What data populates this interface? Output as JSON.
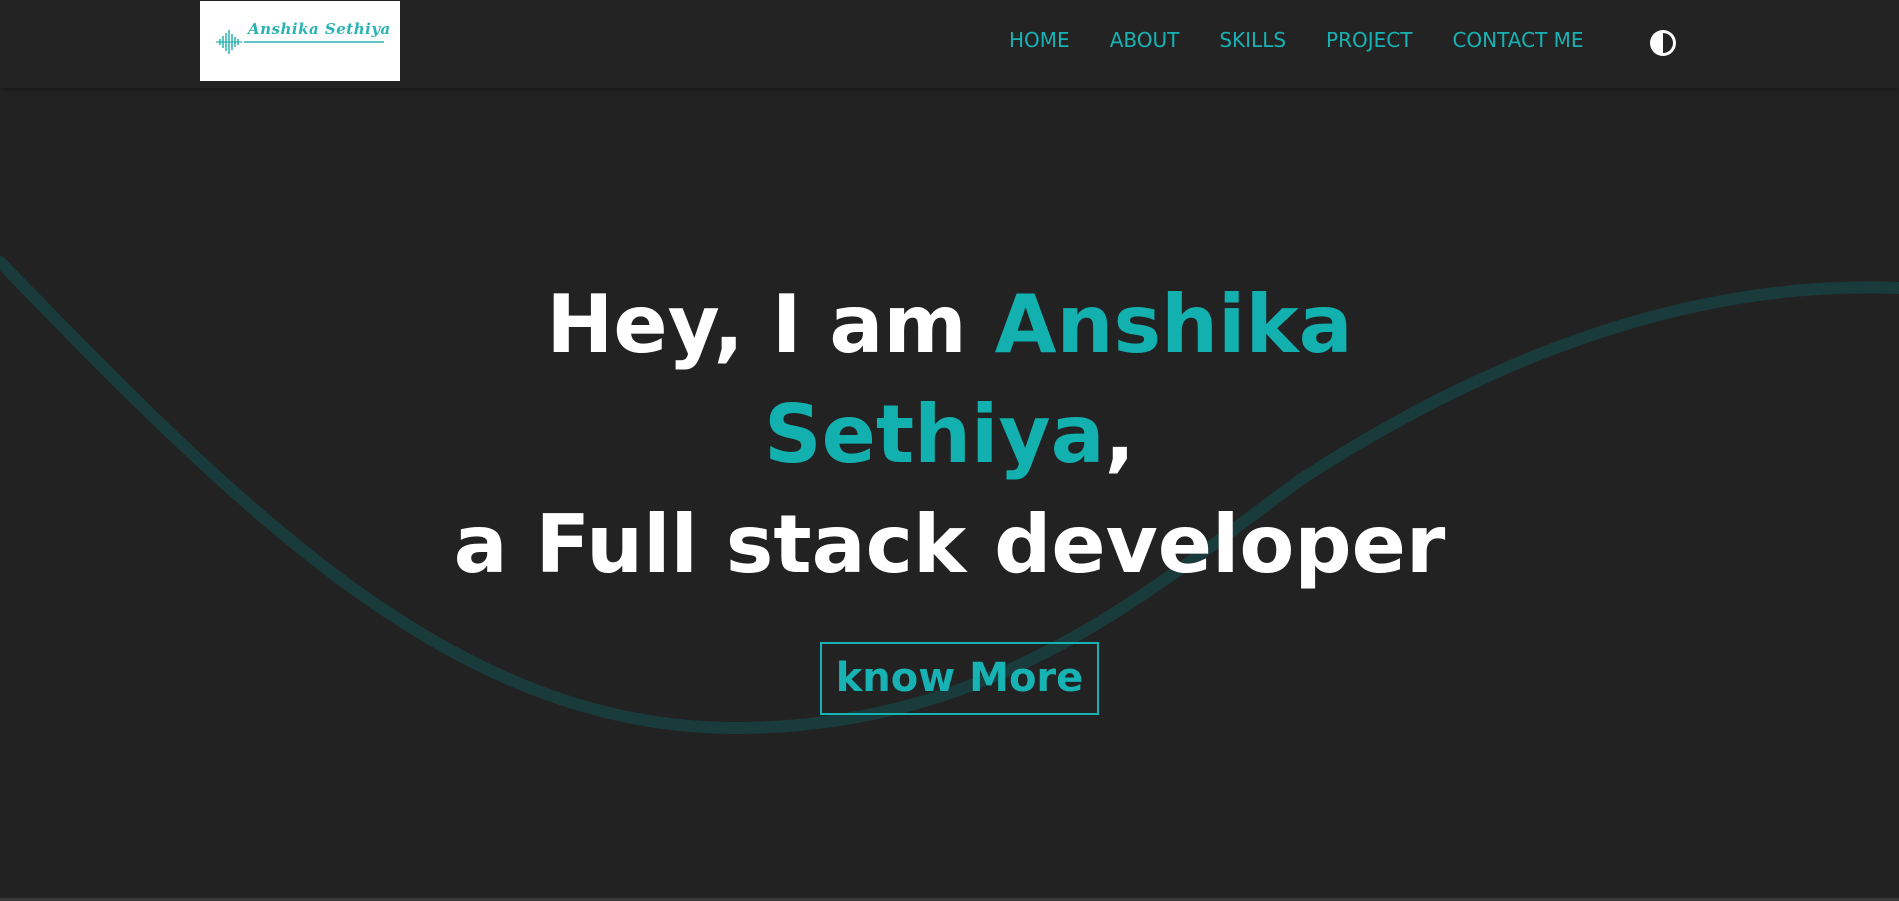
{
  "logo": {
    "text": "Anshika Sethiya",
    "icon": "soundwave-icon"
  },
  "nav": {
    "items": [
      {
        "label": "HOME"
      },
      {
        "label": "ABOUT"
      },
      {
        "label": "SKILLS"
      },
      {
        "label": "PROJECT"
      },
      {
        "label": "CONTACT ME"
      }
    ],
    "theme_toggle_icon": "contrast-half-circle-icon"
  },
  "hero": {
    "greeting": "Hey, I am ",
    "name_first": "Anshika",
    "name_last": "Sethiya",
    "comma": ",",
    "role": "a Full stack developer",
    "button_label": "know More"
  },
  "colors": {
    "background": "#222222",
    "accent": "#17b2b3",
    "text": "#ffffff",
    "wave": "#1a3b3b"
  }
}
